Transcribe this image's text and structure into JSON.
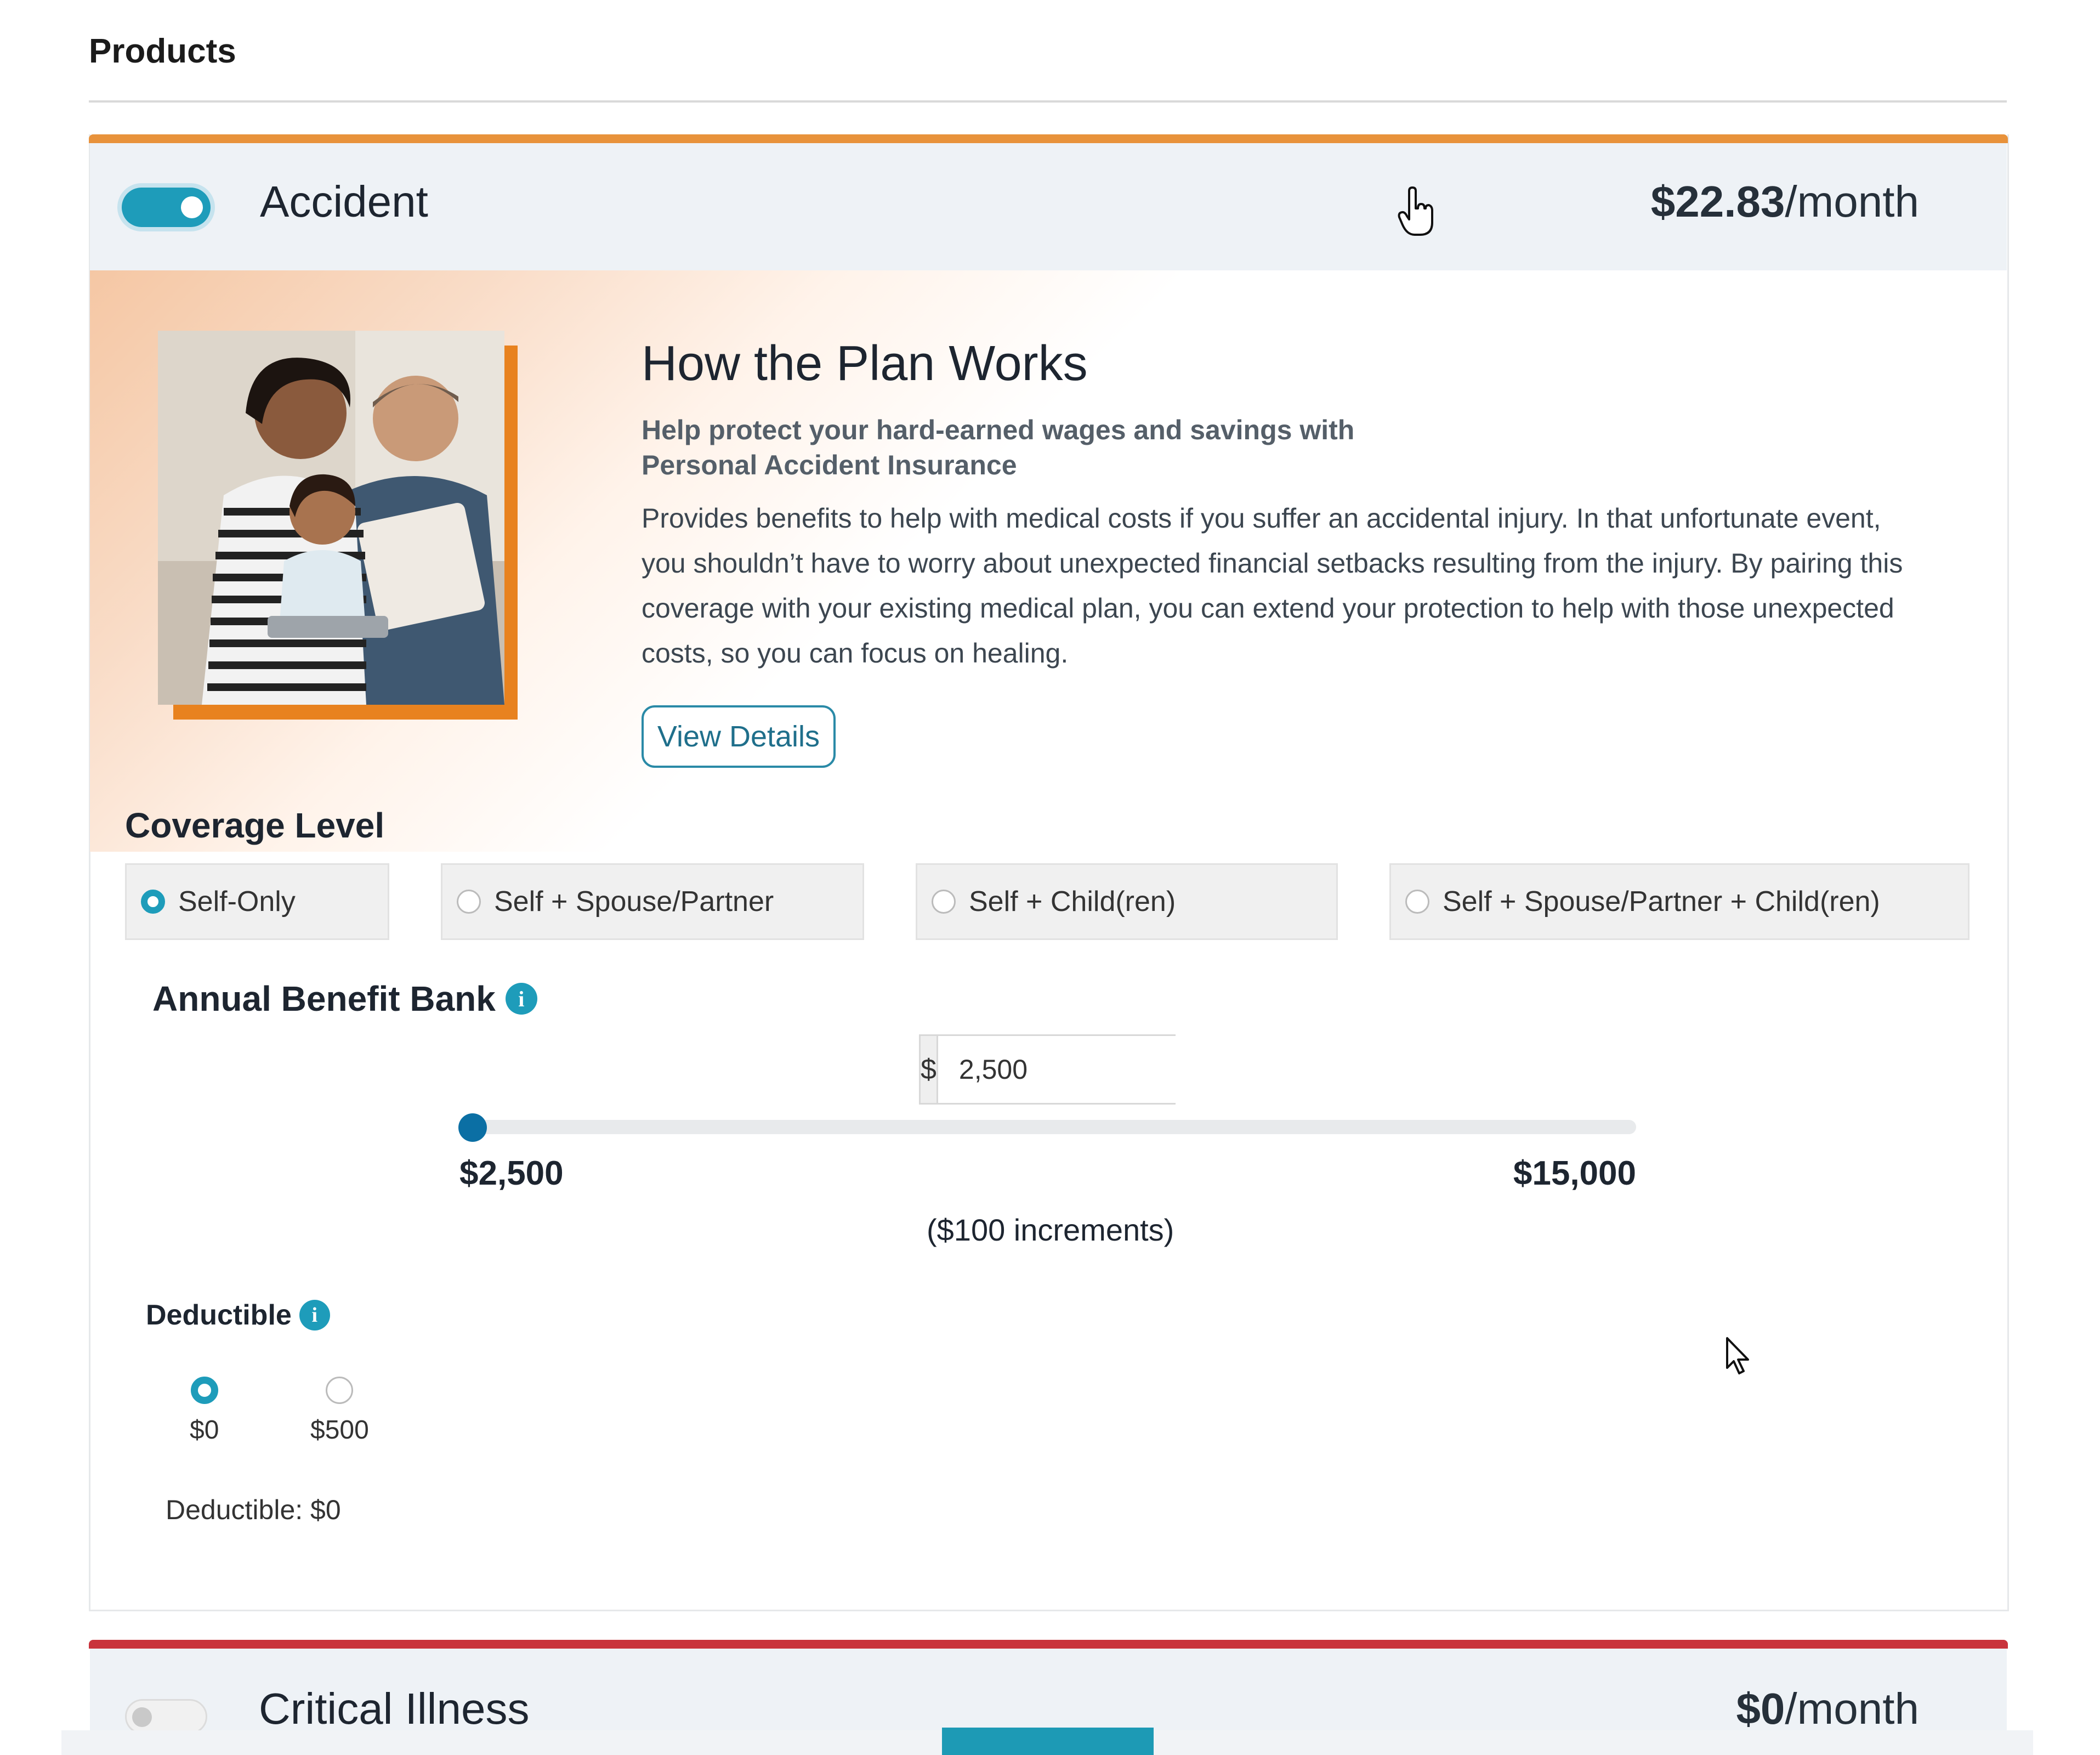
{
  "page": {
    "title": "Products"
  },
  "accident": {
    "name": "Accident",
    "toggle_on": true,
    "price_amount": "$22.83",
    "price_unit": "/month",
    "plan": {
      "title": "How the Plan Works",
      "subtitle": "Help protect your hard-earned wages and savings with Personal Accident Insurance",
      "description": "Provides benefits to help with medical costs if you suffer an accidental injury. In that unfortunate event, you shouldn’t have to worry about unexpected financial setbacks resulting from the injury. By pairing this coverage with your existing medical plan, you can extend your protection to help with those unexpected costs, so you can focus on healing.",
      "view_details_label": "View Details"
    },
    "coverage": {
      "label": "Coverage Level",
      "selected": "Self-Only",
      "options": [
        "Self-Only",
        "Self + Spouse/Partner",
        "Self + Child(ren)",
        "Self + Spouse/Partner + Child(ren)"
      ]
    },
    "benefit_bank": {
      "label": "Annual Benefit Bank",
      "currency_prefix": "$",
      "value": "2,500",
      "min_label": "$2,500",
      "max_label": "$15,000",
      "slider": {
        "min": 2500,
        "max": 15000,
        "value": 2500
      },
      "increments_note": "($100 increments)"
    },
    "deductible": {
      "label": "Deductible",
      "options": [
        "$0",
        "$500"
      ],
      "selected": "$0",
      "summary": "Deductible: $0"
    }
  },
  "critical_illness": {
    "name": "Critical Illness",
    "toggle_on": false,
    "price_amount": "$0",
    "price_unit": "/month"
  },
  "colors": {
    "accent_teal": "#1e9cba",
    "accident_bar": "#e8923b",
    "critical_illness_bar": "#c9333c",
    "slider_thumb": "#0b6fa4"
  },
  "icons": {
    "info": "info-icon",
    "cursor_hand": "hand-pointer-cursor-icon",
    "cursor_arrow": "arrow-cursor-icon"
  }
}
